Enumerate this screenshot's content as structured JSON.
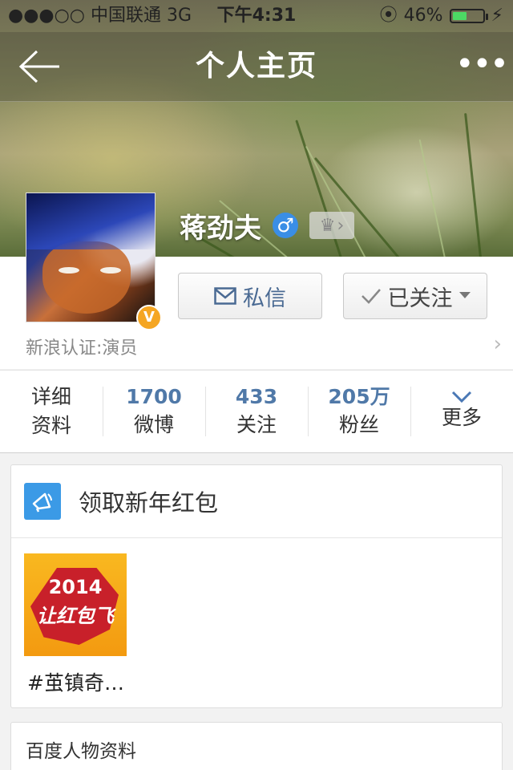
{
  "status": {
    "signal": "●●●○○",
    "carrier": "中国联通",
    "network": "3G",
    "time": "下午4:31",
    "battery": "46%",
    "battery_level": 0.46
  },
  "nav": {
    "title": "个人主页",
    "back_icon": "back-arrow-icon",
    "more_label": "•••"
  },
  "profile": {
    "name": "蒋劲夫",
    "gender_symbol": "♂",
    "verified_mark": "V",
    "verification": "新浪认证:演员"
  },
  "actions": {
    "message_label": "私信",
    "follow_label": "已关注"
  },
  "stats": [
    {
      "value": "",
      "label_top": "详细",
      "label": "资料"
    },
    {
      "value": "1700",
      "label": "微博"
    },
    {
      "value": "433",
      "label": "关注"
    },
    {
      "value": "205万",
      "label": "粉丝"
    },
    {
      "value": "",
      "label": "更多",
      "icon": "chevron-down-icon"
    }
  ],
  "red_packet": {
    "title": "领取新年红包",
    "thumb_line1": "2014",
    "thumb_line2": "让红包飞",
    "caption": "#茧镇奇…"
  },
  "baidu": {
    "title": "百度人物资料"
  },
  "colors": {
    "accent_blue": "#5079a8",
    "gender_blue": "#3a8ee6",
    "verified_orange": "#f5a623",
    "battery_green": "#4cd964"
  }
}
